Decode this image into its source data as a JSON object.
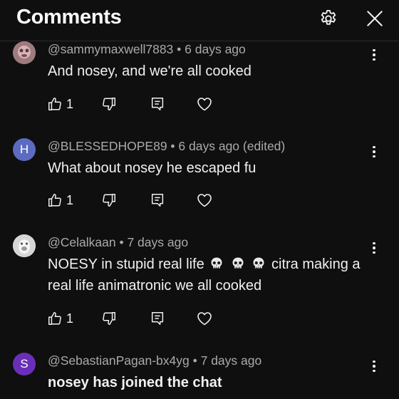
{
  "header": {
    "title": "Comments",
    "settings_icon": "gear-icon",
    "close_icon": "close-icon"
  },
  "colors": {
    "background": "#0f0f0f",
    "text": "#f1f1f1",
    "meta": "#aaaaaa",
    "avatar_h": "#5c6bc0",
    "avatar_s": "#6a2fb8"
  },
  "comments": [
    {
      "author": "@sammymaxwell7883",
      "time": "6 days ago",
      "text": "And nosey, and we're all cooked",
      "likes": "1",
      "avatar": "image"
    },
    {
      "author": "@BLESSEDHOPE89",
      "time": "6 days ago (edited)",
      "text": "What about nosey he escaped fu",
      "likes": "1",
      "avatar": "H"
    },
    {
      "author": "@Celalkaan",
      "time": "7 days ago",
      "text_before": "NOESY in stupid real life",
      "emoji": "skull-emoji",
      "text_after": "citra making a real life animatronic we all cooked",
      "likes": "1",
      "avatar": "image"
    },
    {
      "author": "@SebastianPagan-bx4yg",
      "time": "7 days ago",
      "text": "nosey has joined the chat",
      "avatar": "S"
    }
  ]
}
